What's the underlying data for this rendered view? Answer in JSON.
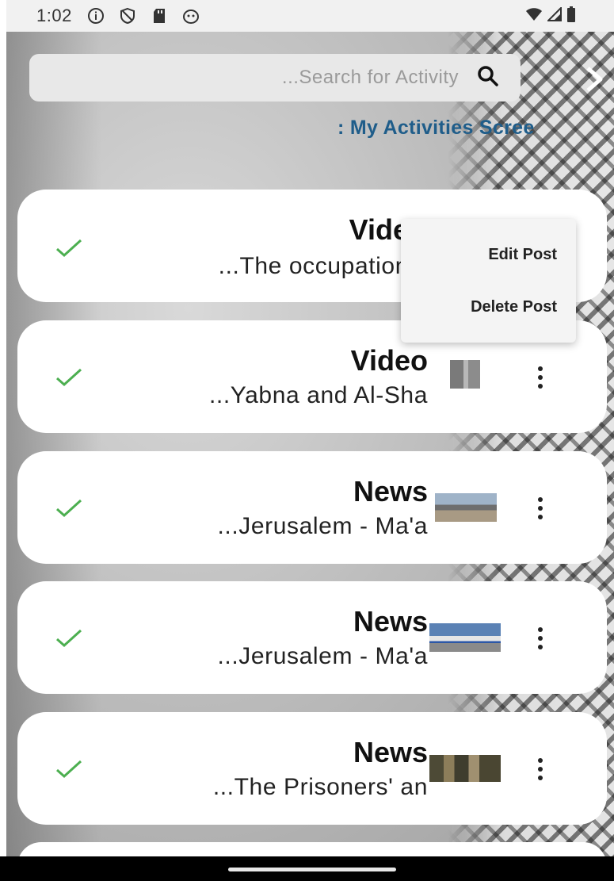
{
  "status_bar": {
    "time": "1:02",
    "icons": [
      "info-icon",
      "shield-icon",
      "sd-card-icon",
      "cat-icon"
    ],
    "right_icons": [
      "wifi-icon",
      "signal-icon",
      "battery-icon"
    ]
  },
  "search": {
    "placeholder": "...Search for Activity",
    "icon": "search-icon"
  },
  "header": {
    "next_icon": "chevron-right-icon",
    "title": ": My Activities Scree"
  },
  "cards": [
    {
      "type": "Vide",
      "description": "...The occupation",
      "status_icon": "check-icon",
      "thumbnail": "none"
    },
    {
      "type": "Video",
      "description": "...Yabna and Al-Sha",
      "status_icon": "check-icon",
      "thumbnail": "building-thumbnail"
    },
    {
      "type": "News",
      "description": "...Jerusalem - Ma'a",
      "status_icon": "check-icon",
      "thumbnail": "airport-thumbnail"
    },
    {
      "type": "News",
      "description": "...Jerusalem - Ma'a",
      "status_icon": "check-icon",
      "thumbnail": "airplane-thumbnail"
    },
    {
      "type": "News",
      "description": "...The Prisoners' an",
      "status_icon": "check-icon",
      "thumbnail": "soldiers-thumbnail"
    }
  ],
  "popup_menu": {
    "items": [
      "Edit Post",
      "Delete Post"
    ]
  },
  "colors": {
    "accent_title": "#1f5d8a",
    "check": "#4caf50",
    "card_bg": "#ffffff"
  }
}
